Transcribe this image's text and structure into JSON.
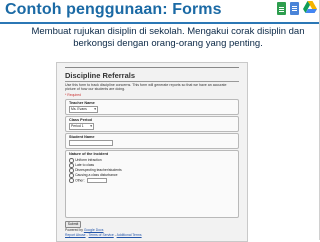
{
  "slide": {
    "title": "Contoh penggunaan: Forms",
    "caption_line1": "Membuat rujukan disiplin di sekolah. Mengakui corak disiplin dan",
    "caption_line2": "berkongsi dengan orang-orang yang penting.",
    "colors": {
      "title": "#1b6aa5",
      "rule": "#2b77b5",
      "caption": "#0b2846"
    },
    "logo_icons": [
      "spreadsheet-icon",
      "document-icon",
      "drive-icon"
    ]
  },
  "form": {
    "title": "Discipline Referrals",
    "description": "Use this form to track discipline concerns. This form will generate reports so that we have an accurate picture of how our students are doing.",
    "required_note": "* Required",
    "teacher": {
      "label": "Teacher Name",
      "value": "Ms. Evans"
    },
    "class_period": {
      "label": "Class Period",
      "value": "Period 1"
    },
    "student": {
      "label": "Student Name",
      "value": ""
    },
    "incident": {
      "label": "Nature of the Incident",
      "options": [
        "Uniform infraction",
        "Late to class",
        "Disrespecting teacher/students",
        "Causing a class disturbance",
        "Other:"
      ]
    },
    "submit_label": "Submit",
    "powered_by": "Powered by",
    "powered_by_link": "Google Docs",
    "footer_links": [
      "Report Abuse",
      "Terms of Service",
      "Additional Terms"
    ],
    "footer_sep": " - "
  }
}
